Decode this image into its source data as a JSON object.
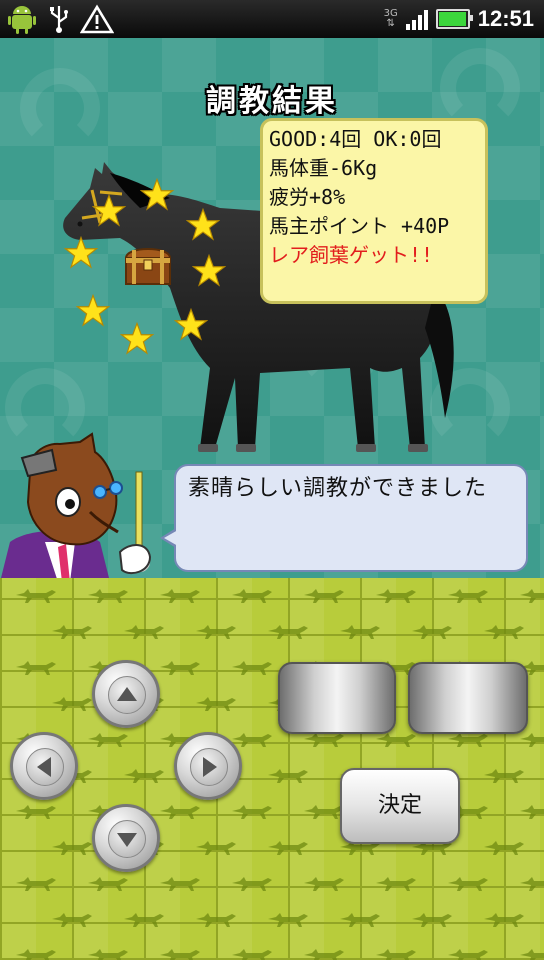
{
  "status_bar": {
    "time": "12:51",
    "network": "3G",
    "icons": [
      "android-icon",
      "usb-icon",
      "warning-icon",
      "signal-icon",
      "battery-icon"
    ],
    "battery_level": 0.9,
    "signal_bars": 4
  },
  "screen": {
    "title": "調教結果",
    "result_lines": [
      "GOOD:4回 OK:0回",
      "馬体重-6Kg",
      "疲労+8%",
      "馬主ポイント +40P"
    ],
    "rare_line": "レア飼葉ゲット!!",
    "message": "素晴らしい調教ができました"
  },
  "controls": {
    "dpad": [
      "up",
      "left",
      "right",
      "down"
    ],
    "decide_label": "決定"
  },
  "colors": {
    "background_teal": "#3e9d8e",
    "controller_green": "#b8cc3b",
    "result_box": "#fbf6a7",
    "rare_text": "#e21d1d",
    "speech_bubble": "#dfe6f5"
  }
}
